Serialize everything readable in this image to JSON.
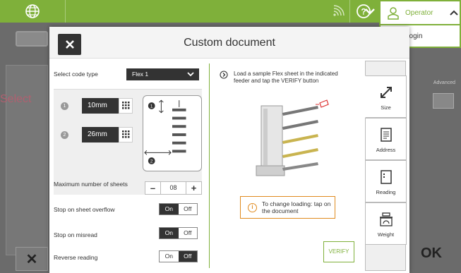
{
  "topbar": {
    "operator_label": "Operator",
    "login_label": "Login"
  },
  "background": {
    "select_partial": "Select",
    "advanced_label": "Advanced",
    "ok_label": "OK",
    "cancel_symbol": "✕"
  },
  "dialog": {
    "title": "Custom document",
    "code_type_label": "Select code type",
    "code_type_value": "Flex 1",
    "dim1_value": "10mm",
    "dim2_value": "26mm",
    "dim1_num": "1",
    "dim2_num": "2",
    "max_sheets_label": "Maximum number of sheets",
    "max_sheets_value": "08",
    "stop_overflow_label": "Stop on sheet overflow",
    "stop_misread_label": "Stop on misread",
    "reverse_reading_label": "Reverse reading",
    "on_label": "On",
    "off_label": "Off",
    "instruction": "Load a sample Flex sheet in the indicated feeder and tap the VERIFY button",
    "note_text": "To change loading: tap on the document",
    "verify_label": "VERIFY",
    "toggles": {
      "stop_overflow": "On",
      "stop_misread": "On",
      "reverse_reading": "Off"
    }
  },
  "tabs": [
    {
      "label": "Size",
      "icon": "resize-icon"
    },
    {
      "label": "Address",
      "icon": "address-icon"
    },
    {
      "label": "Reading",
      "icon": "reading-icon"
    },
    {
      "label": "Weight",
      "icon": "weight-icon"
    }
  ],
  "colors": {
    "accent": "#7fb03a",
    "warning": "#e08a1e",
    "dark": "#333333"
  }
}
